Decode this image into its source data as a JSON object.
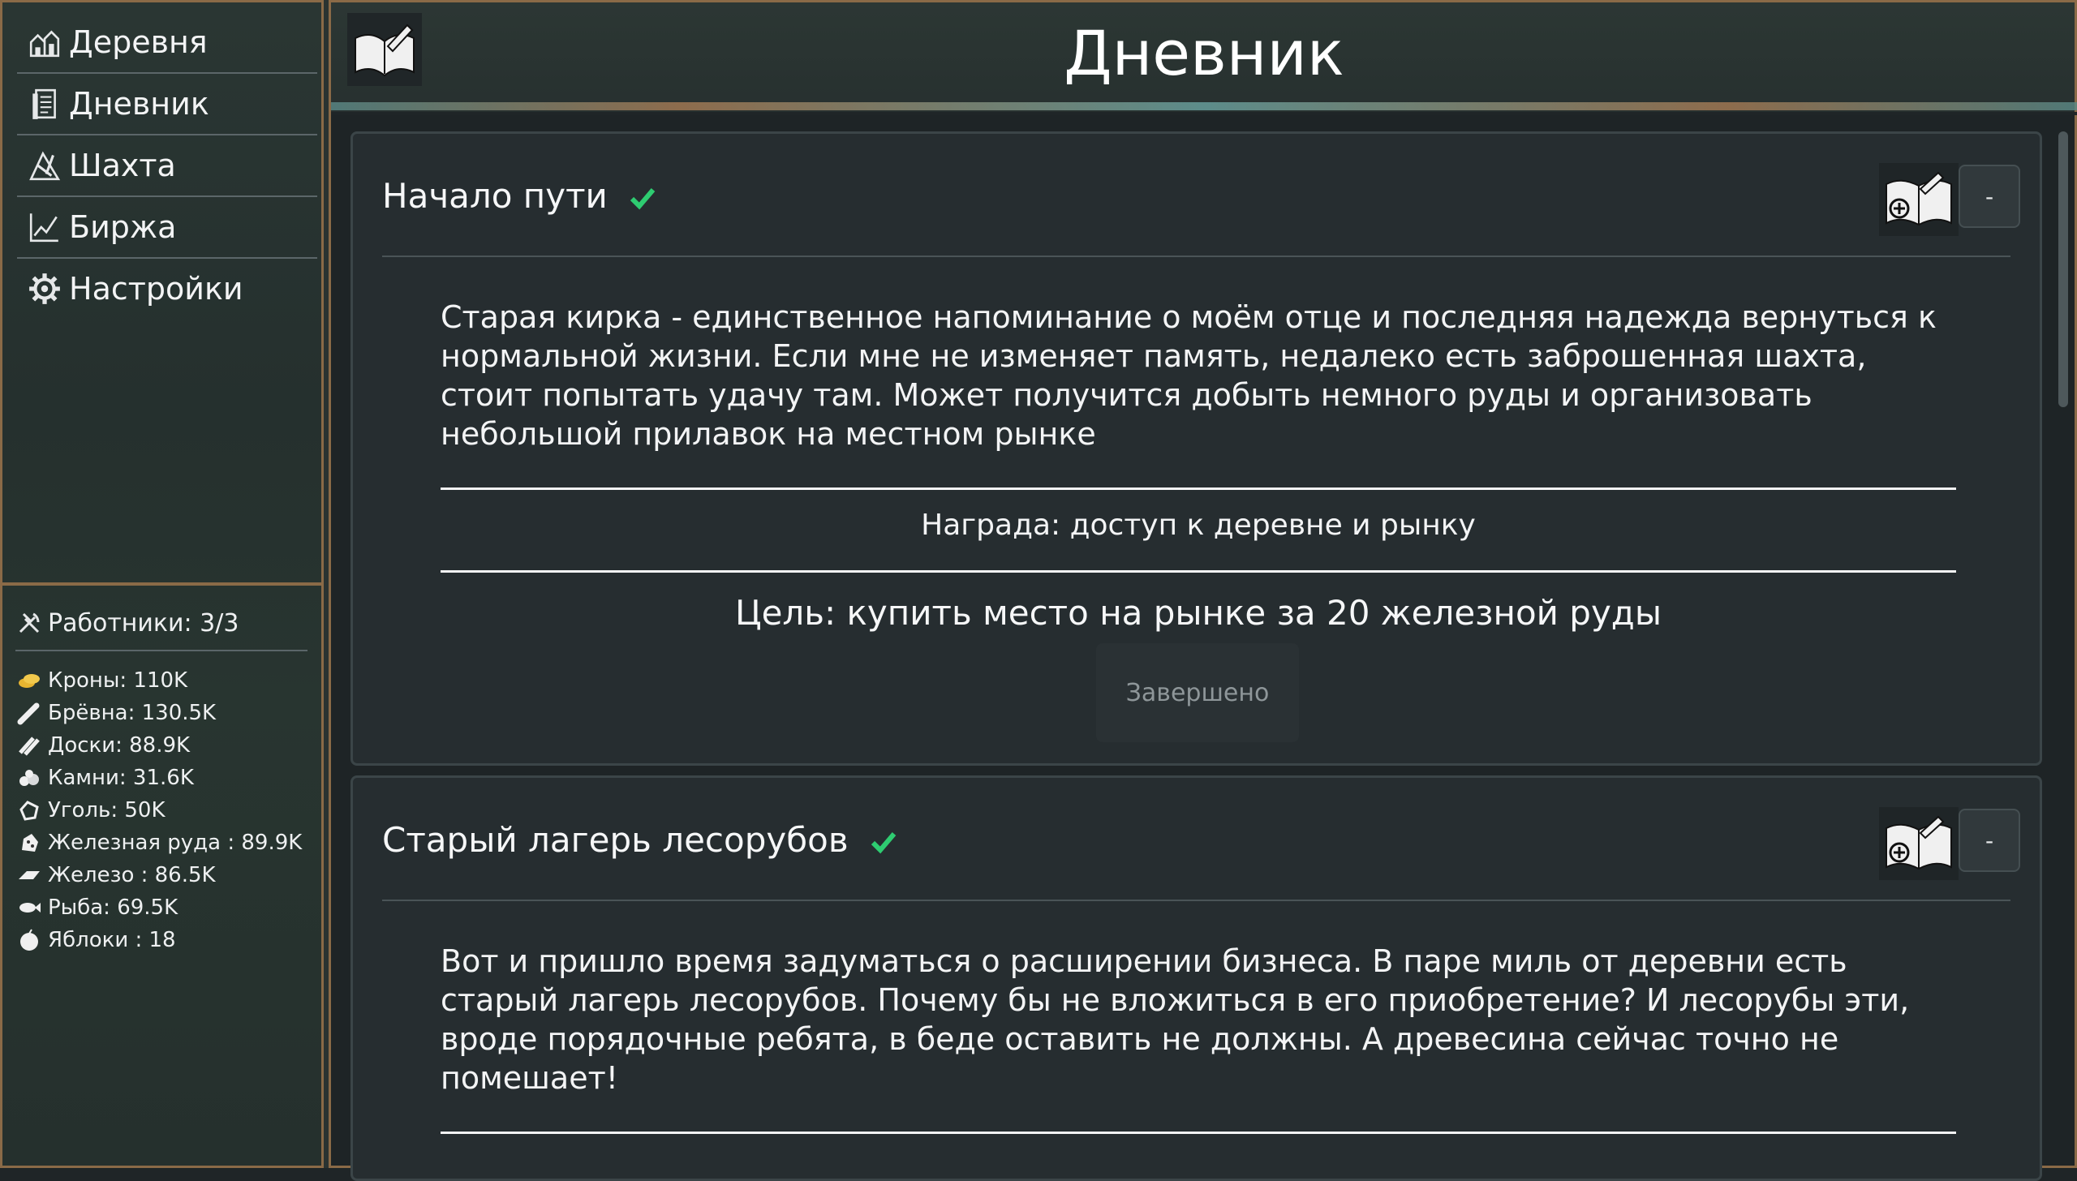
{
  "sidebar": {
    "nav": [
      {
        "label": "Деревня",
        "icon": "village-icon"
      },
      {
        "label": "Дневник",
        "icon": "journal-icon"
      },
      {
        "label": "Шахта",
        "icon": "mine-icon"
      },
      {
        "label": "Биржа",
        "icon": "chart-icon"
      },
      {
        "label": "Настройки",
        "icon": "gear-icon"
      }
    ],
    "workers": {
      "label": "Работники: 3/3",
      "icon": "hammer-pick-icon"
    },
    "resources": [
      {
        "label": "Кроны: 110K",
        "icon": "coins-icon",
        "color": "#e8b530"
      },
      {
        "label": "Брёвна: 130.5K",
        "icon": "logs-icon",
        "color": "#f0f0f0"
      },
      {
        "label": "Доски: 88.9K",
        "icon": "planks-icon",
        "color": "#f0f0f0"
      },
      {
        "label": "Камни: 31.6K",
        "icon": "stones-icon",
        "color": "#f0f0f0"
      },
      {
        "label": "Уголь: 50K",
        "icon": "coal-icon",
        "color": "#f0f0f0"
      },
      {
        "label": "Железная руда : 89.9K",
        "icon": "iron-ore-icon",
        "color": "#f0f0f0"
      },
      {
        "label": "Железо : 86.5K",
        "icon": "iron-ingot-icon",
        "color": "#f0f0f0"
      },
      {
        "label": "Рыба: 69.5K",
        "icon": "fish-icon",
        "color": "#f0f0f0"
      },
      {
        "label": "Яблоки : 18",
        "icon": "apple-icon",
        "color": "#f0f0f0"
      }
    ]
  },
  "header": {
    "title": "Дневник",
    "icon": "journal-book-icon"
  },
  "quests": [
    {
      "title": "Начало пути",
      "completed": true,
      "text": "Старая кирка - единственное напоминание о моём отце и последняя надежда вернуться к нормальной жизни. Если мне не изменяет память, недалеко есть заброшенная шахта, стоит попытать удачу там. Может получится добыть немного руды и организовать небольшой прилавок на местном рынке",
      "reward": "Награда: доступ к деревне и рынку",
      "goal": "Цель: купить место на рынке за 20 железной руды",
      "status": "Завершено",
      "collapse_label": "-"
    },
    {
      "title": "Старый лагерь лесорубов",
      "completed": true,
      "text": "Вот и пришло время задуматься о расширении бизнеса. В паре миль от деревни есть старый лагерь лесорубов. Почему бы не вложиться в его приобретение? И лесорубы эти, вроде порядочные ребята, в беде оставить не должны. А древесина сейчас точно не помешает!",
      "collapse_label": "-"
    }
  ],
  "colors": {
    "check": "#2ecc71",
    "frame": "#8a6a47",
    "panel": "#262d30"
  }
}
